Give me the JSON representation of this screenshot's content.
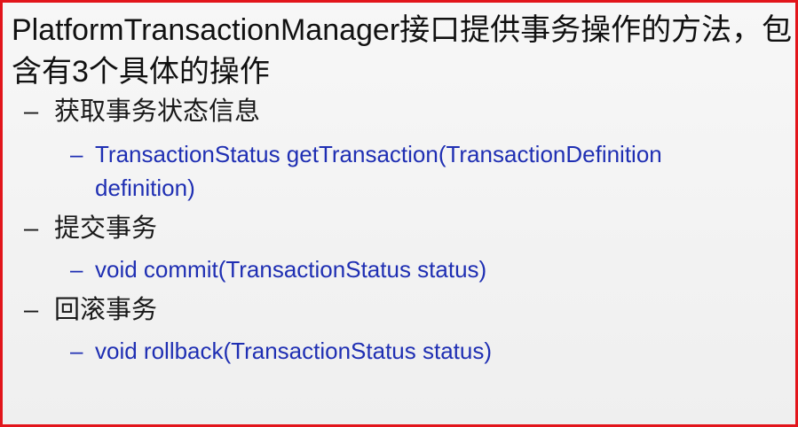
{
  "slide": {
    "title": "PlatformTransactionManager接口提供事务操作的方法，包含有3个具体的操作",
    "items": [
      {
        "dash": "–",
        "label": "获取事务状态信息",
        "sub": {
          "dash": "–",
          "text": "TransactionStatus getTransaction(TransactionDefinition definition)"
        }
      },
      {
        "dash": "–",
        "label": "提交事务",
        "sub": {
          "dash": "–",
          "text": "void commit(TransactionStatus status)"
        }
      },
      {
        "dash": "–",
        "label": "回滚事务",
        "sub": {
          "dash": "–",
          "text": "void rollback(TransactionStatus status)"
        }
      }
    ]
  }
}
